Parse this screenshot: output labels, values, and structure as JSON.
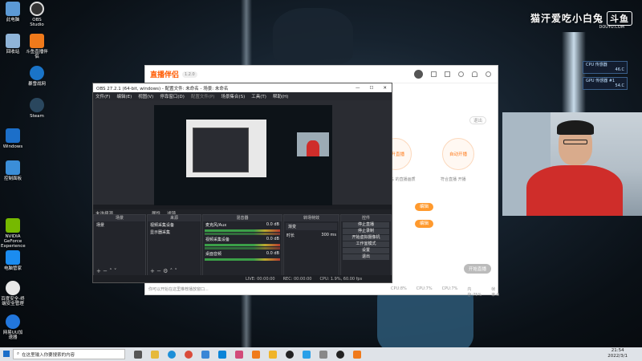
{
  "desktop": {
    "icons": [
      {
        "label": "此电脑",
        "color": "#5c9ad6"
      },
      {
        "label": "OBS Studio",
        "color": "#333333"
      },
      {
        "label": "斗鱼直播伴侣",
        "color": "#f07a1b"
      },
      {
        "label": "回收站",
        "color": "#8fb4d8"
      },
      {
        "label": "暴雪战网",
        "color": "#1a74c8"
      },
      {
        "label": "Steam",
        "color": "#2a475e"
      },
      {
        "label": "Windows",
        "color": "#1c6fc9"
      },
      {
        "label": "控制面板",
        "color": "#3b8ed8"
      },
      {
        "label": "NVIDIA GeForce Experience",
        "color": "#76b900"
      },
      {
        "label": "电脑管家",
        "color": "#1b8cf0"
      },
      {
        "label": "百度安全-终端安全管理",
        "color": "#e8e8e8"
      },
      {
        "label": "网易UU加速器",
        "color": "#2277dd"
      }
    ]
  },
  "watermark": {
    "text": "猫汗爱吃小白兔",
    "logo": "斗鱼",
    "sub": "DOUYU.COM"
  },
  "sensors": [
    {
      "label": "CPU 传感器",
      "value": "46.C"
    },
    {
      "label": "GPU 传感器 #1",
      "value": "54.C"
    }
  ],
  "companion": {
    "logo": "直播伴侣",
    "version": "1.2.0",
    "cards": [
      {
        "title": "提升直播",
        "desc": "行业领先 的直播画质"
      },
      {
        "title": "自动开播",
        "desc": "符合直播 开播"
      }
    ],
    "buttons": [
      "编辑",
      "编辑"
    ],
    "exit_label": "退出",
    "bottom_stats": [
      "CPU:8%",
      "CPU:7%",
      "CPU:7%",
      "内存:75%",
      "帧率:0"
    ],
    "notice": "你可以开始在这里推荐播放窗口...",
    "start_label": "开始直播"
  },
  "obs": {
    "title": "OBS 27.2.1 (64-bit, windows) - 配置文件: 未命名 - 场景: 未命名",
    "menu": [
      "文件(F)",
      "编辑(E)",
      "视图(V)",
      "停靠窗口(D)",
      "配置文件(P)",
      "场景集合(S)",
      "工具(T)",
      "帮助(H)"
    ],
    "status": "未选择源",
    "status_props": "属性",
    "status_filters": "滤镜",
    "docks": {
      "scenes": {
        "title": "场景",
        "items": [
          "场景"
        ]
      },
      "sources": {
        "title": "来源",
        "items": [
          "视频采集设备",
          "显示器采集"
        ]
      },
      "mixer": {
        "title": "混音器",
        "items": [
          {
            "name": "麦克风/Aux",
            "db": "0.0 dB"
          },
          {
            "name": "视频采集设备",
            "db": "0.0 dB"
          },
          {
            "name": "桌面音频",
            "db": "0.0 dB"
          }
        ]
      },
      "transitions": {
        "title": "转场特效",
        "value": "渐变",
        "duration_label": "时长",
        "duration": "300 ms"
      },
      "controls": {
        "title": "控件",
        "buttons": [
          "停止直播",
          "停止录制",
          "开始虚拟摄像机",
          "工作室模式",
          "设置",
          "退出"
        ]
      }
    },
    "footer": {
      "live": "LIVE: 00:00:00",
      "rec": "REC: 00:00:00",
      "cpu": "CPU: 1.9%, 60.00 fps"
    }
  },
  "taskbar": {
    "search_placeholder": "在这里输入你要搜索的内容",
    "time": "21:54",
    "date": "2022/3/1"
  }
}
